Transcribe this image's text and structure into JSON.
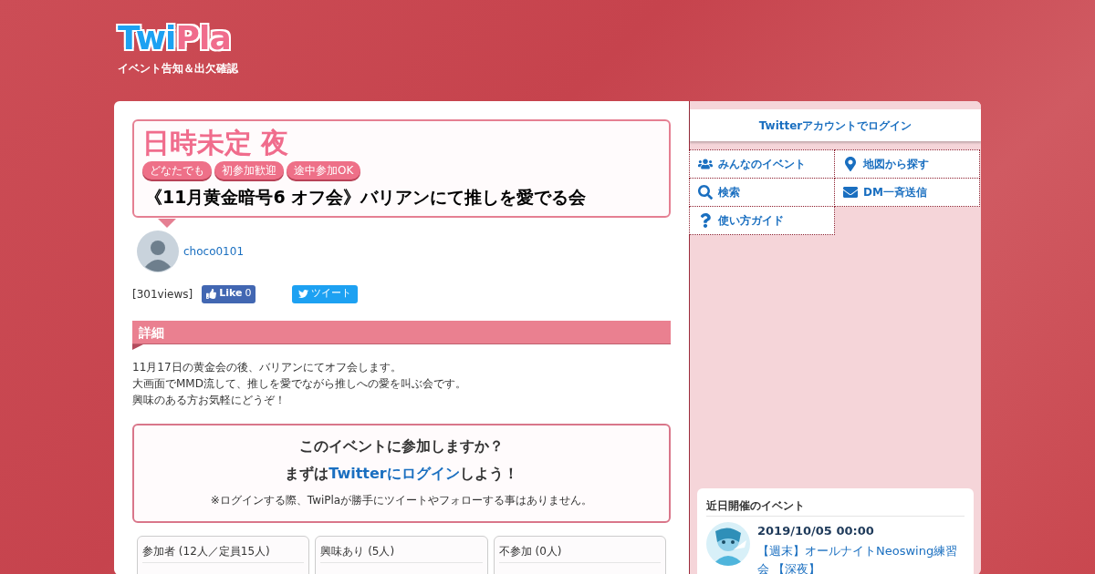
{
  "logo": {
    "part_1": "Twi",
    "part_2": "Pla",
    "tagline": "イベント告知＆出欠確認"
  },
  "event": {
    "date": "日時未定 夜",
    "tags": [
      "どなたでも",
      "初参加歓迎",
      "途中参加OK"
    ],
    "title": "《11月黄金暗号6 オフ会》バリアンにて推しを愛でる会",
    "organizer": "choco0101",
    "views": "[301views]",
    "like": {
      "label": "Like",
      "count": "0"
    },
    "tweet": "ツイート"
  },
  "details": {
    "heading": "詳細",
    "lines": [
      "11月17日の黄金会の後、バリアンにてオフ会します。",
      "大画面でMMD流して、推しを愛でながら推しへの愛を叫ぶ会です。",
      "興味のある方お気軽にどうぞ！"
    ]
  },
  "join": {
    "question": "このイベントに参加しますか？",
    "prompt_before": "まずは",
    "prompt_link": "Twitterにログイン",
    "prompt_after": "しよう！",
    "note": "※ログインする際、TwiPlaが勝手にツイートやフォローする事はありません。"
  },
  "attendance": [
    {
      "label": "参加者 (12人／定員15人)"
    },
    {
      "label": "興味あり (5人)"
    },
    {
      "label": "不参加 (0人)"
    }
  ],
  "sidebar": {
    "login": "Twitterアカウントでログイン",
    "menu": [
      {
        "label": "みんなのイベント"
      },
      {
        "label": "地図から探す"
      },
      {
        "label": "検索"
      },
      {
        "label": "DM一斉送信"
      },
      {
        "label": "使い方ガイド"
      }
    ],
    "upcoming": {
      "heading": "近日開催のイベント",
      "events": [
        {
          "date": "2019/10/05 00:00",
          "title": "【週末】オールナイトNeoswing練習会 【深夜】",
          "kind": "picture"
        }
      ]
    }
  }
}
